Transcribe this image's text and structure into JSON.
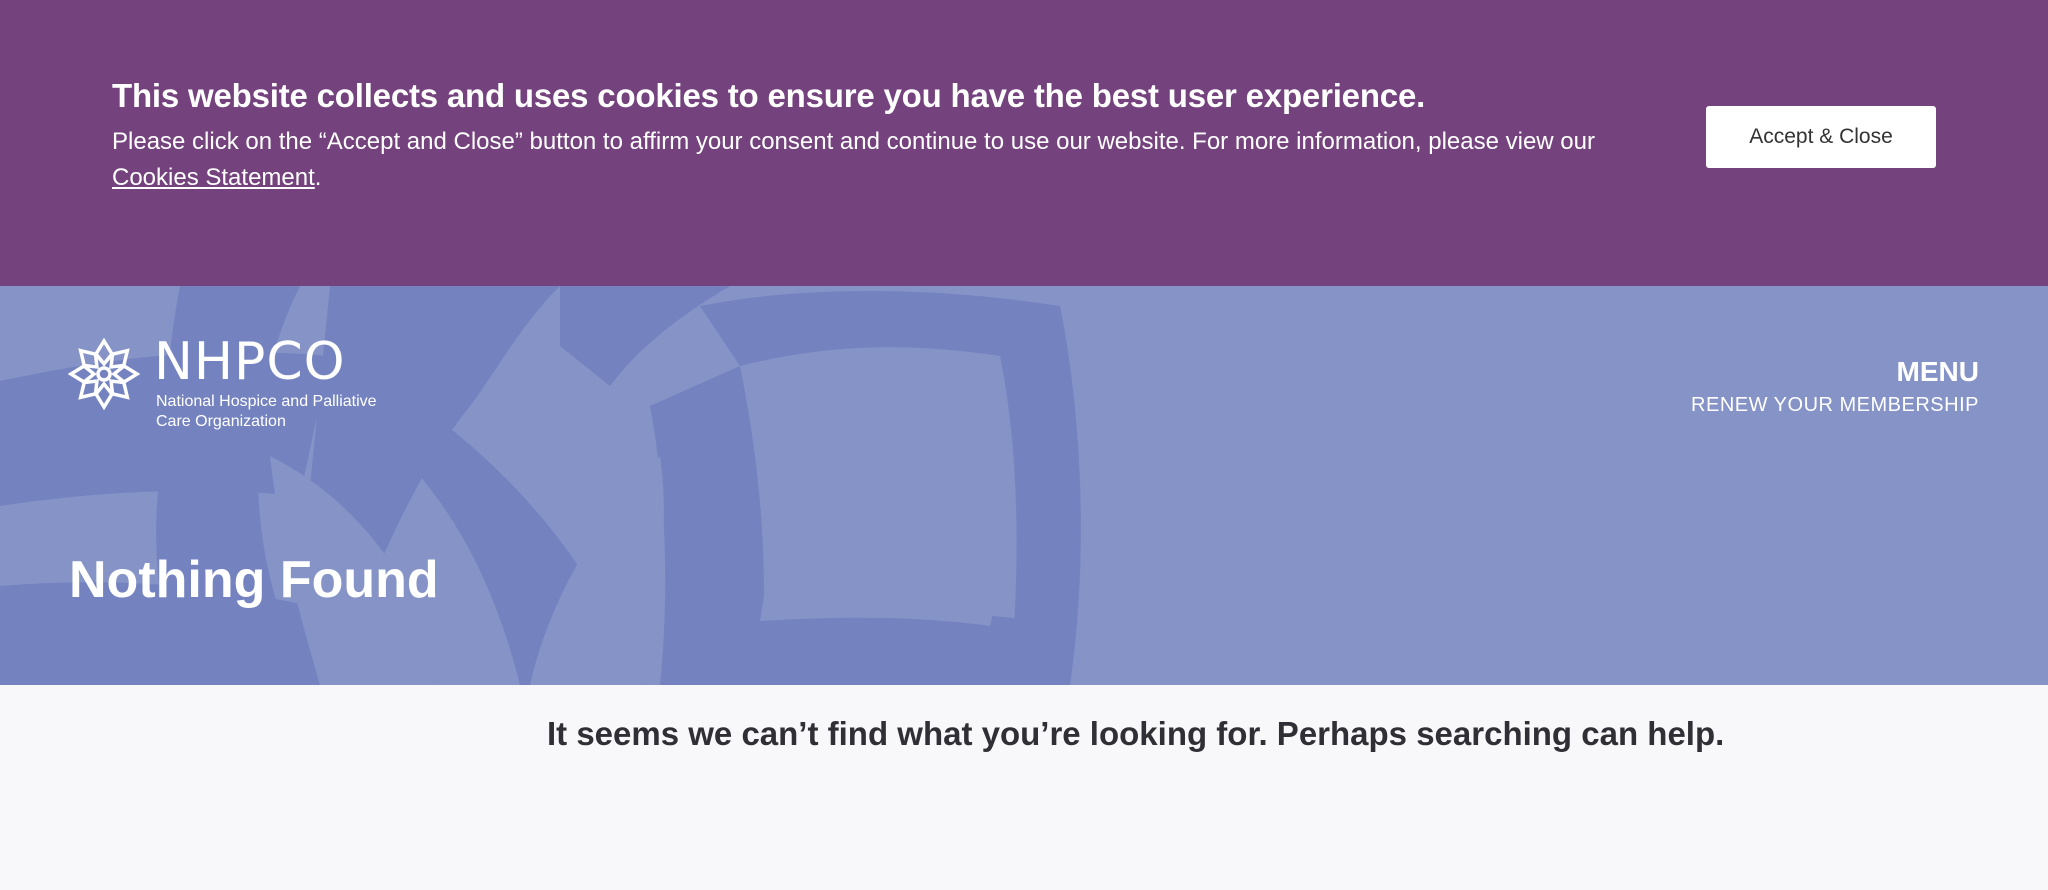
{
  "cookie_banner": {
    "title": "This website collects and uses cookies to ensure you have the best user experience.",
    "text_before_link": "Please click on the “Accept and Close” button to affirm your consent and continue to use our website. For more information, please view our ",
    "link_label": "Cookies Statement",
    "text_after_link": ".",
    "accept_label": "Accept & Close",
    "background_color": "#74427d"
  },
  "header": {
    "logo": {
      "wordmark": "NHPCO",
      "subtitle_line1": "National Hospice and Palliative",
      "subtitle_line2": "Care Organization",
      "icon": "flower-icon"
    },
    "menu_label": "MENU",
    "renew_label": "RENEW YOUR MEMBERSHIP",
    "background_color": "#8593c7"
  },
  "main": {
    "title": "Nothing Found",
    "message": "It seems we can’t find what you’re looking for. Perhaps searching can help."
  }
}
